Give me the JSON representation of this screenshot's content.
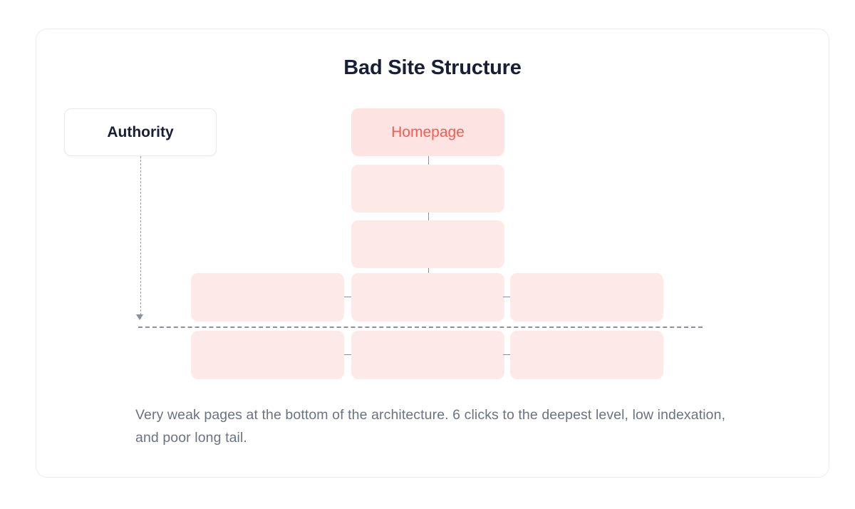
{
  "card": {
    "title": "Bad Site Structure",
    "caption": "Very weak pages at the bottom of the architecture. 6 clicks to the deepest level, low indexation, and poor long tail.",
    "border_color": "#ececf0",
    "background": "#ffffff"
  },
  "diagram": {
    "type": "site-architecture",
    "authority_label": "Authority",
    "homepage_label": "Homepage",
    "accent_color": "#fb5b50",
    "node_fill": "#fdeae8",
    "title_color": "#1a1f36",
    "caption_color": "#6b7280",
    "connector_color": "#8b8fa3",
    "depth_levels": 5,
    "columns": 3,
    "authority_cut_after_level": 4,
    "nodes": [
      {
        "id": "l1-c2",
        "level": 1,
        "column": "mid",
        "label": "Homepage",
        "labelled": true
      },
      {
        "id": "l2-c2",
        "level": 2,
        "column": "mid",
        "label": "",
        "labelled": false
      },
      {
        "id": "l3-c2",
        "level": 3,
        "column": "mid",
        "label": "",
        "labelled": false
      },
      {
        "id": "l4-c1",
        "level": 4,
        "column": "left",
        "label": "",
        "labelled": false
      },
      {
        "id": "l4-c2",
        "level": 4,
        "column": "mid",
        "label": "",
        "labelled": false
      },
      {
        "id": "l4-c3",
        "level": 4,
        "column": "right",
        "label": "",
        "labelled": false
      },
      {
        "id": "l5-c1",
        "level": 5,
        "column": "left",
        "label": "",
        "labelled": false
      },
      {
        "id": "l5-c2",
        "level": 5,
        "column": "mid",
        "label": "",
        "labelled": false
      },
      {
        "id": "l5-c3",
        "level": 5,
        "column": "right",
        "label": "",
        "labelled": false
      }
    ]
  }
}
